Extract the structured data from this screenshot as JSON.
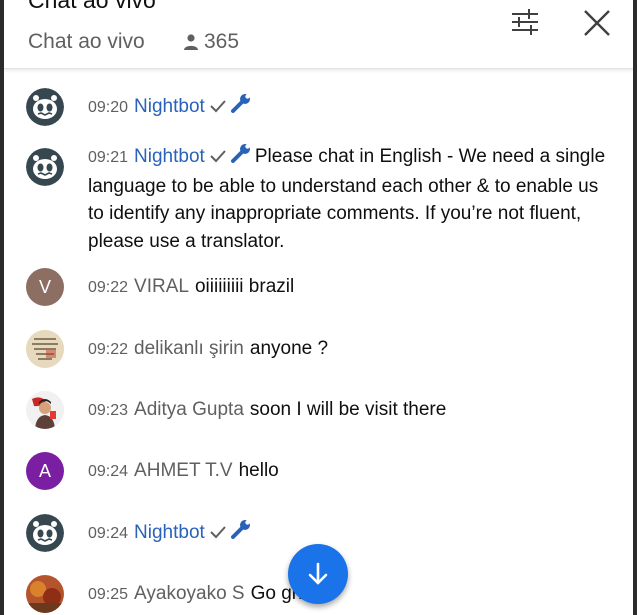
{
  "header": {
    "title": "Chat ao vivo",
    "subtitle": "Chat ao vivo",
    "viewer_count": "365"
  },
  "messages": [
    {
      "time": "09:20",
      "author": "Nightbot",
      "text": "",
      "avatar": "nightbot"
    },
    {
      "time": "09:21",
      "author": "Nightbot",
      "text": "Please chat in English - We need a single language to be able to understand each other & to enable us to identify any inappropriate comments. If you’re not fluent, please use a translator.",
      "avatar": "nightbot"
    },
    {
      "time": "09:22",
      "author": "VIRAL",
      "text": "oiiiiiiiii brazil",
      "avatar_letter": "V",
      "avatar_color": "#8d6e63"
    },
    {
      "time": "09:22",
      "author": "delikanlı şirin",
      "text": "anyone ?",
      "avatar": "photo"
    },
    {
      "time": "09:23",
      "author": "Aditya Gupta",
      "text": "soon I will be visit there",
      "avatar": "photo"
    },
    {
      "time": "09:24",
      "author": "AHMET T.V",
      "text": "hello",
      "avatar_letter": "A",
      "avatar_color": "#7b1fa2"
    },
    {
      "time": "09:24",
      "author": "Nightbot",
      "text": "",
      "avatar": "nightbot"
    },
    {
      "time": "09:25",
      "author": "Ayakoyako S",
      "text": "Go     ght.",
      "avatar": "photo"
    }
  ],
  "colors": {
    "moderator_name": "#2962b8",
    "fab": "#1a73e8"
  },
  "icons": {
    "filter": "sliders-icon",
    "close": "close-icon",
    "viewer": "person-icon",
    "verified": "check-icon",
    "moderator": "wrench-icon",
    "scroll": "arrow-down-icon"
  }
}
